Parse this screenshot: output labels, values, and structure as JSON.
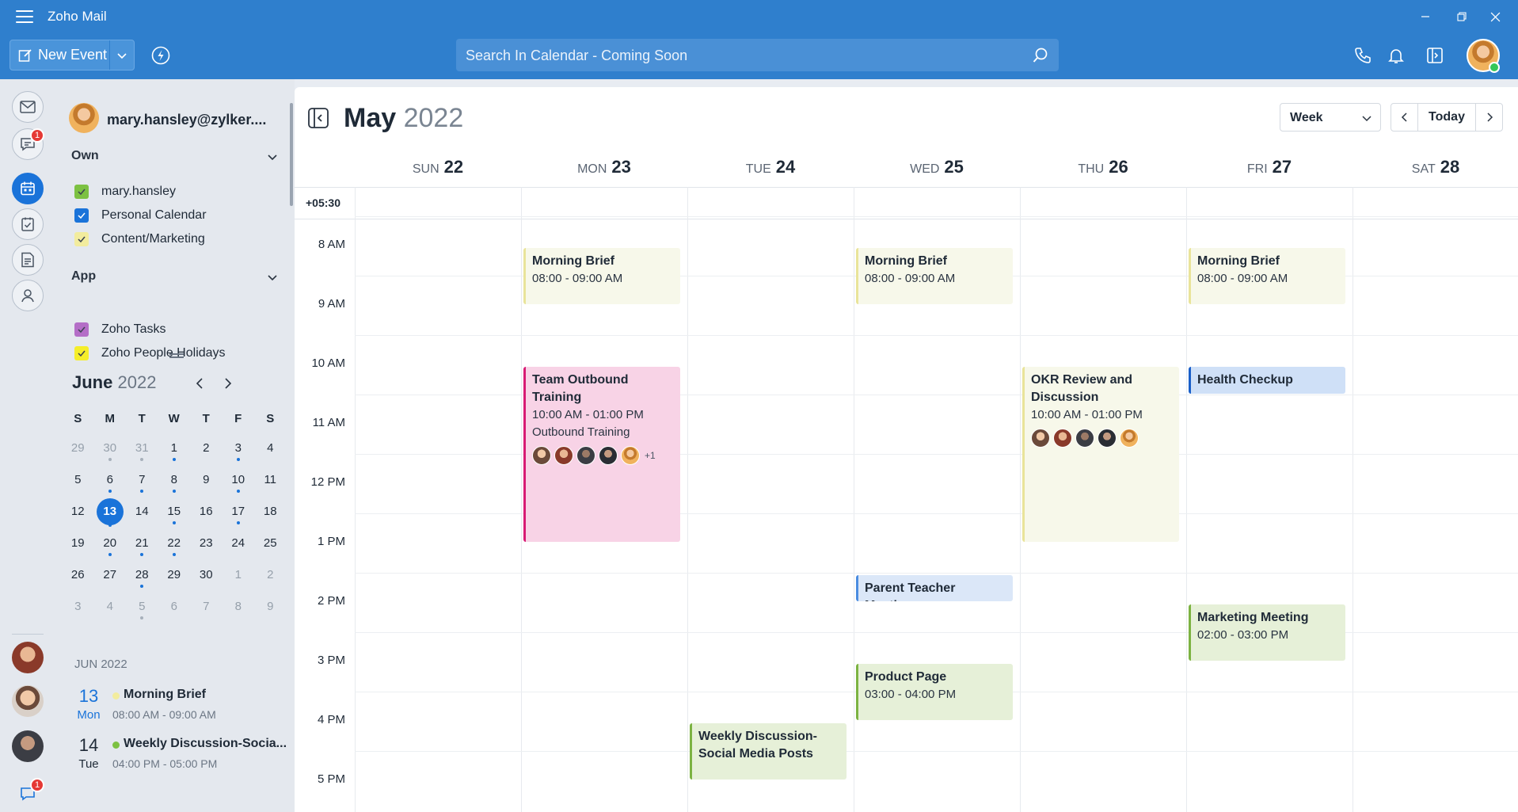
{
  "app": {
    "title": "Zoho Mail"
  },
  "toolbar": {
    "new_event_label": "New Event",
    "search_placeholder": "Search In Calendar - Coming Soon"
  },
  "rail": {
    "chat_badge": "1",
    "bottom_badge": "1"
  },
  "sidebar": {
    "account_email": "mary.hansley@zylker....",
    "own_label": "Own",
    "own_calendars": [
      {
        "name": "mary.hansley",
        "color": "#7cc142"
      },
      {
        "name": "Personal Calendar",
        "color": "#1a73d9"
      },
      {
        "name": "Content/Marketing",
        "color": "#f2ec9e"
      }
    ],
    "app_label": "App",
    "app_calendars": [
      {
        "name": "Zoho Tasks",
        "color": "#b46ec7"
      },
      {
        "name": "Zoho People Holidays",
        "color": "#f5ee2a"
      }
    ]
  },
  "mini_cal": {
    "month": "June",
    "year": "2022",
    "weekdays": [
      "S",
      "M",
      "T",
      "W",
      "T",
      "F",
      "S"
    ],
    "weeks": [
      [
        {
          "d": "29",
          "m": true,
          "dot": false
        },
        {
          "d": "30",
          "m": true,
          "dot": true
        },
        {
          "d": "31",
          "m": true,
          "dot": true
        },
        {
          "d": "1",
          "m": false,
          "dot": true
        },
        {
          "d": "2",
          "m": false,
          "dot": false
        },
        {
          "d": "3",
          "m": false,
          "dot": true
        },
        {
          "d": "4",
          "m": false,
          "dot": false
        }
      ],
      [
        {
          "d": "5",
          "m": false,
          "dot": false
        },
        {
          "d": "6",
          "m": false,
          "dot": true
        },
        {
          "d": "7",
          "m": false,
          "dot": true
        },
        {
          "d": "8",
          "m": false,
          "dot": true
        },
        {
          "d": "9",
          "m": false,
          "dot": false
        },
        {
          "d": "10",
          "m": false,
          "dot": true
        },
        {
          "d": "11",
          "m": false,
          "dot": false
        }
      ],
      [
        {
          "d": "12",
          "m": false,
          "dot": false
        },
        {
          "d": "13",
          "m": false,
          "dot": true,
          "today": true
        },
        {
          "d": "14",
          "m": false,
          "dot": false
        },
        {
          "d": "15",
          "m": false,
          "dot": true
        },
        {
          "d": "16",
          "m": false,
          "dot": false
        },
        {
          "d": "17",
          "m": false,
          "dot": true
        },
        {
          "d": "18",
          "m": false,
          "dot": false
        }
      ],
      [
        {
          "d": "19",
          "m": false,
          "dot": false
        },
        {
          "d": "20",
          "m": false,
          "dot": true
        },
        {
          "d": "21",
          "m": false,
          "dot": true
        },
        {
          "d": "22",
          "m": false,
          "dot": true
        },
        {
          "d": "23",
          "m": false,
          "dot": false
        },
        {
          "d": "24",
          "m": false,
          "dot": false
        },
        {
          "d": "25",
          "m": false,
          "dot": false
        }
      ],
      [
        {
          "d": "26",
          "m": false,
          "dot": false
        },
        {
          "d": "27",
          "m": false,
          "dot": false
        },
        {
          "d": "28",
          "m": false,
          "dot": true
        },
        {
          "d": "29",
          "m": false,
          "dot": false
        },
        {
          "d": "30",
          "m": false,
          "dot": false
        },
        {
          "d": "1",
          "m": true,
          "dot": false
        },
        {
          "d": "2",
          "m": true,
          "dot": false
        }
      ],
      [
        {
          "d": "3",
          "m": true,
          "dot": false
        },
        {
          "d": "4",
          "m": true,
          "dot": false
        },
        {
          "d": "5",
          "m": true,
          "dot": true
        },
        {
          "d": "6",
          "m": true,
          "dot": false
        },
        {
          "d": "7",
          "m": true,
          "dot": false
        },
        {
          "d": "8",
          "m": true,
          "dot": false
        },
        {
          "d": "9",
          "m": true,
          "dot": false
        }
      ]
    ]
  },
  "agenda": {
    "header": "JUN 2022",
    "items": [
      {
        "day": "13",
        "weekday": "Mon",
        "title": "Morning Brief",
        "time": "08:00 AM - 09:00 AM",
        "color": "#f2ec9e",
        "highlight": true
      },
      {
        "day": "14",
        "weekday": "Tue",
        "title": "Weekly Discussion-Socia...",
        "time": "04:00 PM - 05:00 PM",
        "color": "#7cc142",
        "highlight": false
      }
    ]
  },
  "calendar": {
    "month": "May",
    "year": "2022",
    "view": "Week",
    "today_label": "Today",
    "timezone": "+05:30",
    "days": [
      {
        "wd": "SUN",
        "num": "22"
      },
      {
        "wd": "MON",
        "num": "23"
      },
      {
        "wd": "TUE",
        "num": "24"
      },
      {
        "wd": "WED",
        "num": "25"
      },
      {
        "wd": "THU",
        "num": "26"
      },
      {
        "wd": "FRI",
        "num": "27"
      },
      {
        "wd": "SAT",
        "num": "28"
      }
    ],
    "hours": [
      "8 AM",
      "9 AM",
      "10 AM",
      "11 AM",
      "12 PM",
      "1 PM",
      "2 PM",
      "3 PM",
      "4 PM",
      "5 PM"
    ],
    "events": [
      {
        "day": 1,
        "start": 8,
        "end": 9,
        "title": "Morning Brief",
        "time": "08:00 - 09:00 AM",
        "bg": "#f7f8ea",
        "border": "#e9e49a"
      },
      {
        "day": 3,
        "start": 8,
        "end": 9,
        "title": "Morning Brief",
        "time": "08:00 - 09:00 AM",
        "bg": "#f7f8ea",
        "border": "#e9e49a"
      },
      {
        "day": 5,
        "start": 8,
        "end": 9,
        "title": "Morning Brief",
        "time": "08:00 - 09:00 AM",
        "bg": "#f7f8ea",
        "border": "#e9e49a"
      },
      {
        "day": 1,
        "start": 10,
        "end": 13,
        "title": "Team Outbound Training",
        "time": "10:00 AM - 01:00 PM",
        "sub": "Outbound Training",
        "bg": "#f8d3e6",
        "border": "#d81b74",
        "people": 5,
        "more": "+1"
      },
      {
        "day": 4,
        "start": 10,
        "end": 13,
        "title": "OKR Review and Discussion",
        "time": "10:00 AM - 01:00 PM",
        "bg": "#f7f8ea",
        "border": "#e9e49a",
        "people": 5
      },
      {
        "day": 5,
        "start": 10,
        "end": 10.5,
        "title": "Health Checkup",
        "bg": "#cfe0f7",
        "border": "#1a5fc9"
      },
      {
        "day": 3,
        "start": 13.5,
        "end": 14,
        "title": "Parent Teacher Meeting",
        "bg": "#dbe7f8",
        "border": "#4a8ce0"
      },
      {
        "day": 5,
        "start": 14,
        "end": 15,
        "title": "Marketing Meeting",
        "time": "02:00 - 03:00 PM",
        "bg": "#e6f0d8",
        "border": "#7cb342"
      },
      {
        "day": 3,
        "start": 15,
        "end": 16,
        "title": "Product Page",
        "time": "03:00 - 04:00 PM",
        "bg": "#e6f0d8",
        "border": "#7cb342"
      },
      {
        "day": 2,
        "start": 16,
        "end": 17,
        "title": "Weekly Discussion-Social Media Posts",
        "bg": "#e6f0d8",
        "border": "#7cb342"
      }
    ]
  }
}
